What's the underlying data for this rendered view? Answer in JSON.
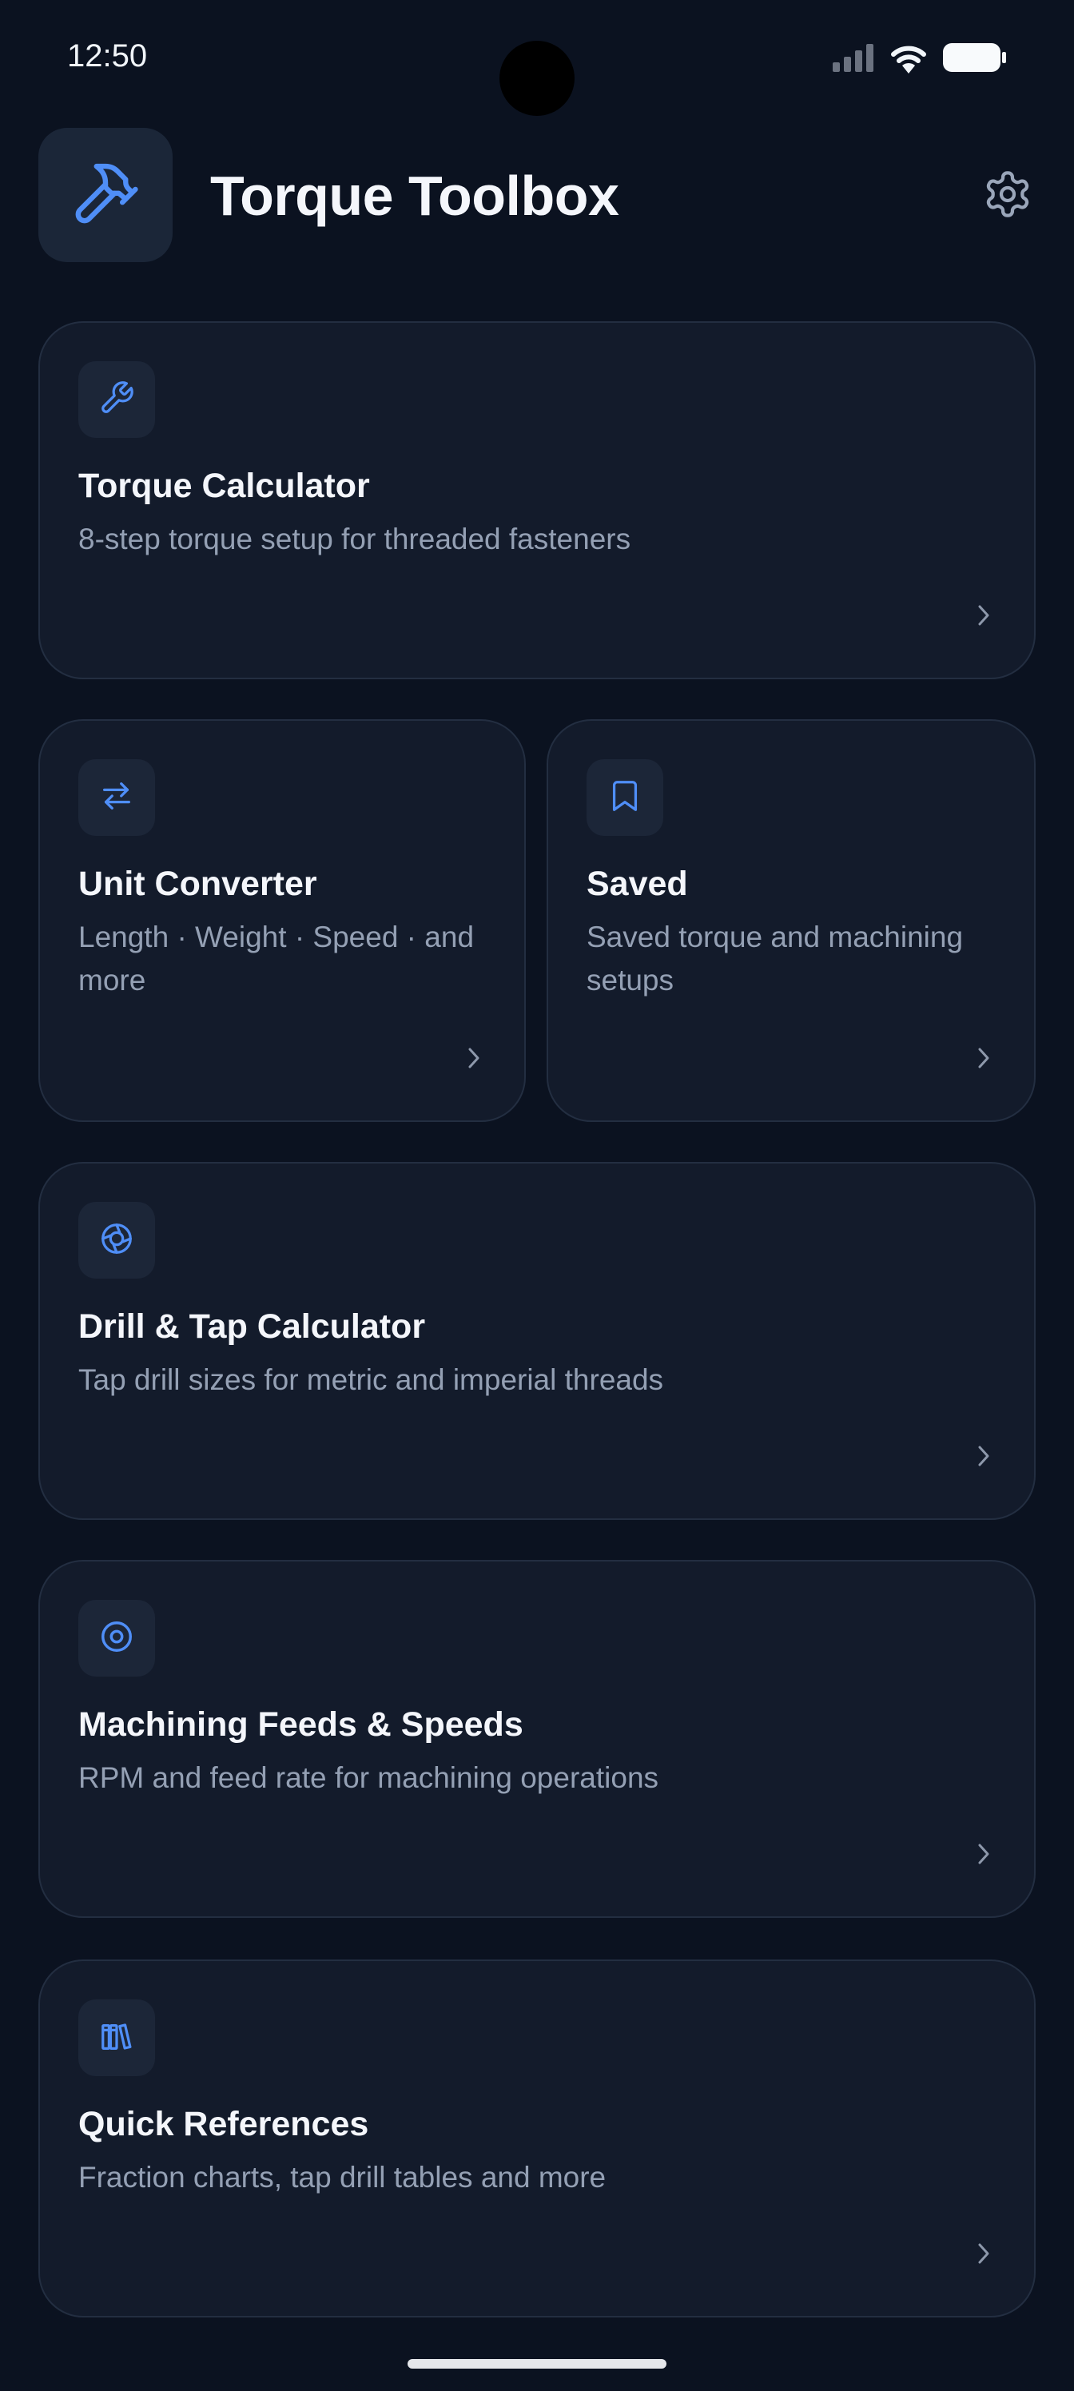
{
  "status_bar": {
    "time": "12:50",
    "signal_icon": "signal-icon",
    "wifi_icon": "wifi-icon",
    "battery_icon": "battery-icon"
  },
  "header": {
    "title": "Torque Toolbox",
    "logo_icon": "hammer-wrench-icon",
    "settings_icon": "gear-icon"
  },
  "colors": {
    "background": "#0b1220",
    "card": "#131b2b",
    "accent": "#4f8ef7",
    "text_primary": "#f4f6fb",
    "text_secondary": "#94a0b4"
  },
  "cards": [
    {
      "title": "Torque Calculator",
      "subtitle": "8-step torque setup for threaded fasteners",
      "icon": "wrench-icon"
    },
    {
      "title": "Unit Converter",
      "subtitle": "Length · Weight · Speed · and more",
      "icon": "arrows-swap-icon"
    },
    {
      "title": "Saved",
      "subtitle": "Saved torque and machining setups",
      "icon": "bookmark-icon"
    },
    {
      "title": "Drill & Tap Calculator",
      "subtitle": "Tap drill sizes for metric and imperial threads",
      "icon": "drill-bit-icon"
    },
    {
      "title": "Machining Feeds & Speeds",
      "subtitle": "RPM and feed rate for machining operations",
      "icon": "target-icon"
    },
    {
      "title": "Quick References",
      "subtitle": "Fraction charts, tap drill tables and more",
      "icon": "books-icon"
    }
  ]
}
